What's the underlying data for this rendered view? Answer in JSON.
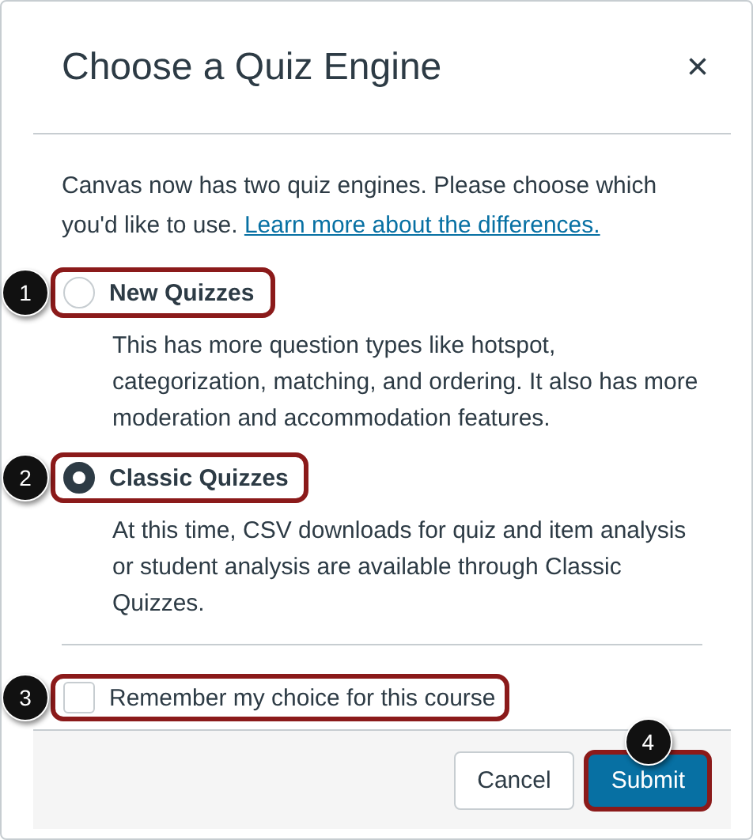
{
  "dialog": {
    "title": "Choose a Quiz Engine",
    "close": "×",
    "intro": "Canvas now has two quiz engines. Please choose which you'd like to use.",
    "intro_link": "Learn more about the differences.",
    "options": [
      {
        "label": "New Quizzes",
        "selected": false,
        "callout": "1",
        "description": "This has more question types like hotspot, categorization, matching, and ordering. It also has more moderation and accommodation features."
      },
      {
        "label": "Classic Quizzes",
        "selected": true,
        "callout": "2",
        "description": "At this time, CSV downloads for quiz and item analysis or student analysis are available through Classic Quizzes."
      }
    ],
    "remember": {
      "label": "Remember my choice for this course",
      "checked": false,
      "callout": "3"
    },
    "buttons": [
      {
        "label": "Cancel",
        "kind": "secondary"
      },
      {
        "label": "Submit",
        "kind": "primary",
        "callout": "4"
      }
    ]
  }
}
